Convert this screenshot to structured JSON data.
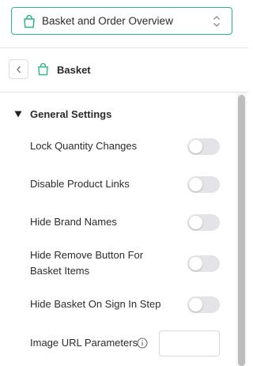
{
  "header": {
    "page_select_label": "Basket and Order Overview",
    "page_select_icon": "shopping-bag-icon"
  },
  "section": {
    "title": "Basket",
    "icon": "shopping-bag-icon"
  },
  "group": {
    "title": "General Settings",
    "expanded": true
  },
  "settings": [
    {
      "label": "Lock Quantity Changes",
      "enabled": false
    },
    {
      "label": "Disable Product Links",
      "enabled": false
    },
    {
      "label": "Hide Brand Names",
      "enabled": false
    },
    {
      "label": "Hide Remove Button For Basket Items",
      "enabled": false
    },
    {
      "label": "Hide Basket On Sign In Step",
      "enabled": false
    }
  ],
  "image_url_parameters": {
    "label": "Image URL Parameters",
    "value": ""
  },
  "colors": {
    "accent": "#2bb589",
    "toggle_off": "#e3e3e8"
  }
}
